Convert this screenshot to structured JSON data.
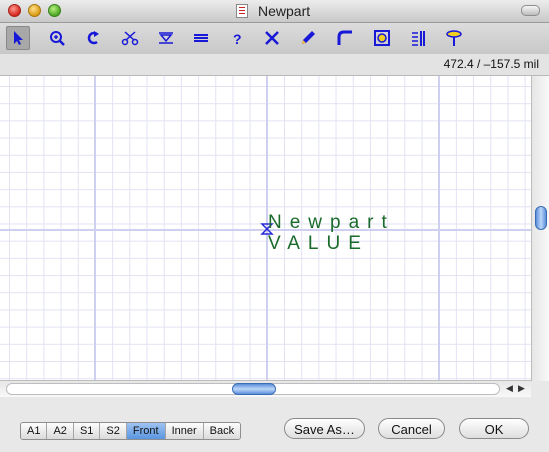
{
  "window": {
    "title": "Newpart"
  },
  "toolbar": {
    "tools": [
      {
        "name": "pointer-icon",
        "selected": true
      },
      {
        "name": "zoom-icon"
      },
      {
        "name": "rotate-icon"
      },
      {
        "name": "scissors-icon"
      },
      {
        "name": "pin-icon"
      },
      {
        "name": "bus-icon"
      },
      {
        "name": "help-icon"
      },
      {
        "name": "no-connect-icon"
      },
      {
        "name": "pencil-icon"
      },
      {
        "name": "corner-icon"
      },
      {
        "name": "target-icon"
      },
      {
        "name": "align-icon"
      },
      {
        "name": "probe-icon"
      }
    ],
    "accent": "#1818d8"
  },
  "status": {
    "coordinates": "472.4 / –157.5 mil"
  },
  "canvas": {
    "part_name": "Newpart",
    "part_value": "VALUE",
    "text_color": "#1a6b2b"
  },
  "layers": {
    "items": [
      "A1",
      "A2",
      "S1",
      "S2",
      "Front",
      "Inner",
      "Back"
    ],
    "selected": "Front"
  },
  "buttons": {
    "save_as": "Save As…",
    "cancel": "Cancel",
    "ok": "OK"
  }
}
